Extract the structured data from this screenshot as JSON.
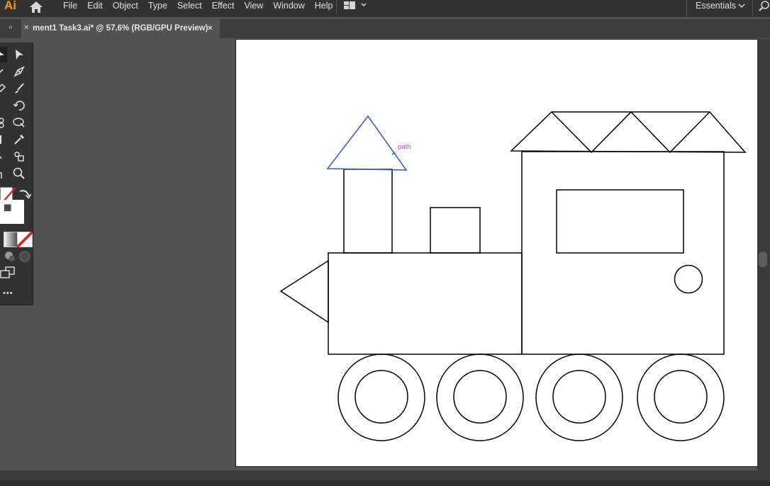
{
  "app": {
    "logo": "Ai"
  },
  "menu": [
    "File",
    "Edit",
    "Object",
    "Type",
    "Select",
    "Effect",
    "View",
    "Window",
    "Help"
  ],
  "workspace": {
    "label": "Essentials"
  },
  "document_tab": {
    "title": "ment1 Task3.ai* @ 57.6% (RGB/GPU Preview)",
    "close": "×",
    "collapse": "«",
    "left_close": "×"
  },
  "canvas": {
    "selection_hint": "path"
  },
  "toolbar": {
    "more": "•••"
  },
  "colors": {
    "selection": "#3a5fcd",
    "hint": "#d63ad6",
    "accent": "#ff9a00"
  }
}
